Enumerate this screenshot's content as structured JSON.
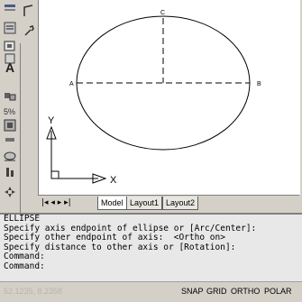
{
  "toolbar_left": {
    "items": [
      {
        "name": "grip-icon",
        "glyph": ""
      },
      {
        "name": "properties-icon",
        "glyph": ""
      },
      {
        "name": "block-icon",
        "glyph": ""
      },
      {
        "name": "insert-icon",
        "glyph": ""
      },
      {
        "name": "text-icon",
        "glyph": "A"
      },
      {
        "name": "modify-icon",
        "glyph": ""
      },
      {
        "name": "dimension-icon",
        "glyph": ""
      },
      {
        "name": "layer-icon",
        "glyph": ""
      },
      {
        "name": "hatch-icon",
        "glyph": ""
      },
      {
        "name": "region-icon",
        "glyph": ""
      },
      {
        "name": "point-icon",
        "glyph": ""
      },
      {
        "name": "move-icon",
        "glyph": ""
      }
    ]
  },
  "drawing": {
    "point_labels": {
      "a": "A",
      "b": "B",
      "c": "C"
    },
    "ucs": {
      "x_label": "X",
      "y_label": "Y"
    }
  },
  "layout_tabs": {
    "nav": "|◂ ◂ ▸ ▸|",
    "tabs": [
      "Model",
      "Layout1",
      "Layout2"
    ],
    "active": "Model"
  },
  "command_window": {
    "lines": [
      "ELLIPSE",
      "Specify axis endpoint of ellipse or [Arc/Center]:",
      "Specify other endpoint of axis:  <Ortho on>",
      "Specify distance to other axis or [Rotation]:",
      "Command:",
      "Command:"
    ]
  },
  "status_bar": {
    "coords": "52.1235, 8.2358",
    "buttons": [
      "SNAP",
      "GRID",
      "ORTHO",
      "POLAR"
    ]
  }
}
